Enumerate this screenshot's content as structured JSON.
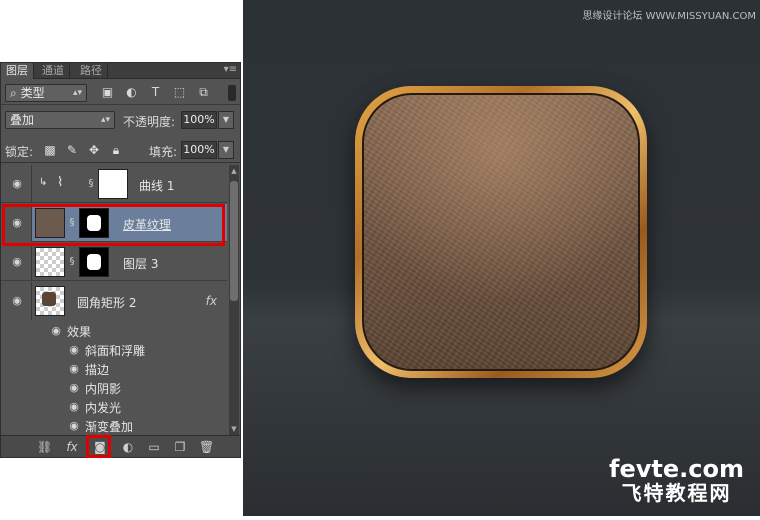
{
  "panel": {
    "tabs": [
      {
        "label": "图层",
        "active": true
      },
      {
        "label": "通道",
        "active": false
      },
      {
        "label": "路径",
        "active": false
      }
    ],
    "filter": {
      "kind_label": "类型"
    },
    "blend_mode": "叠加",
    "opacity": {
      "label": "不透明度:",
      "value": "100%"
    },
    "lock": {
      "label": "锁定:"
    },
    "fill": {
      "label": "填充:",
      "value": "100%"
    },
    "layers": [
      {
        "name": "曲线 1",
        "selected": false
      },
      {
        "name": "皮革纹理",
        "selected": true
      },
      {
        "name": "图层 3",
        "selected": false
      },
      {
        "name": "圆角矩形 2",
        "selected": false,
        "fx": "fx"
      }
    ],
    "effects": {
      "label": "效果",
      "items": [
        "斜面和浮雕",
        "描边",
        "内阴影",
        "内发光",
        "渐变叠加"
      ]
    },
    "bottom_icons": [
      "link-icon",
      "fx-icon",
      "add-mask-icon",
      "adjustment-icon",
      "folder-icon",
      "new-layer-icon",
      "trash-icon"
    ],
    "highlight_color": "#e00000",
    "selection_color": "#6b7f9c"
  },
  "canvas": {
    "watermark_top": "思缘设计论坛 WWW.MISSYUAN.COM",
    "logo_line1": "fevte.com",
    "logo_line2": "飞特教程网"
  }
}
